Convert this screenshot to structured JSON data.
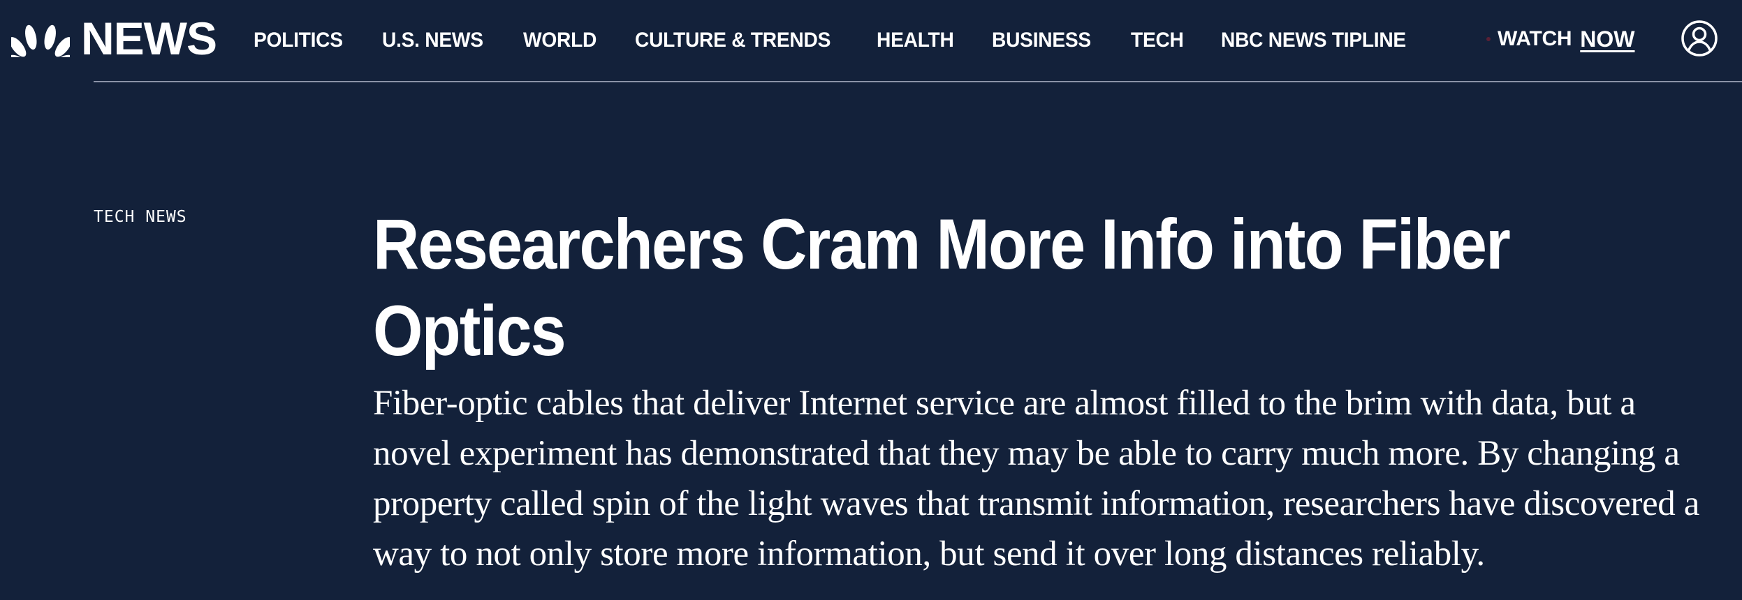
{
  "header": {
    "logo_text": "NEWS",
    "logo_icon": "nbc-peacock-icon",
    "nav_items": [
      {
        "label": "POLITICS"
      },
      {
        "label": "U.S. NEWS"
      },
      {
        "label": "WORLD"
      },
      {
        "label": "CULTURE & TRENDS"
      },
      {
        "label": "HEALTH"
      },
      {
        "label": "BUSINESS"
      },
      {
        "label": "TECH"
      },
      {
        "label": "NBC NEWS TIPLINE"
      }
    ],
    "watch_label": "WATCH",
    "watch_now_label": "NOW",
    "account_icon": "user-account-icon"
  },
  "article": {
    "section_label": "TECH NEWS",
    "headline": "Researchers Cram More Info into Fiber Optics",
    "dek": "Fiber-optic cables that deliver Internet service are almost filled to the brim with data, but a novel experiment has demonstrated that they may be able to carry much more. By changing a property called spin of the light waves that transmit information, researchers have discovered a way to not only store more information, but send it over long distances reliably."
  },
  "colors": {
    "background": "#13213a",
    "text": "#ffffff",
    "rule": "#8b93a7"
  }
}
